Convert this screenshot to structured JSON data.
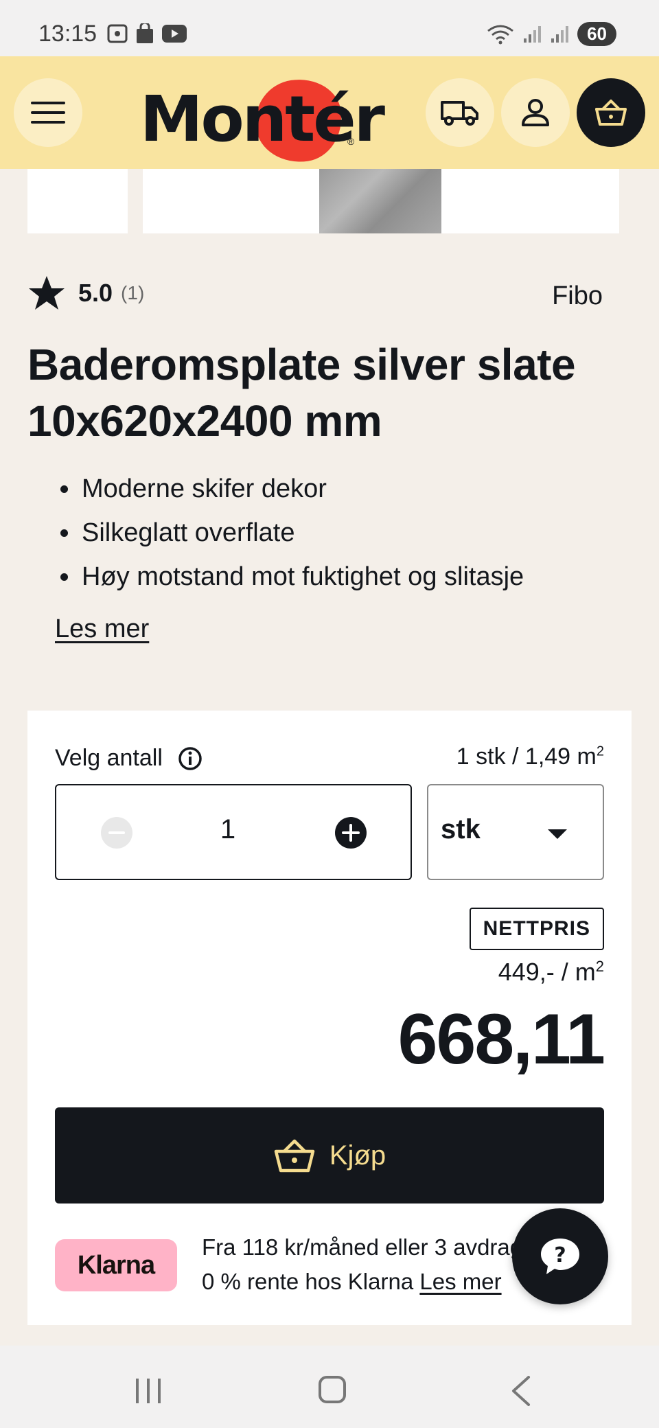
{
  "status_bar": {
    "time": "13:15",
    "battery": "60"
  },
  "header": {
    "logo": "Montér",
    "icons": [
      "menu-icon",
      "truck-icon",
      "user-icon",
      "cart-icon"
    ]
  },
  "product": {
    "rating": "5.0",
    "rating_count": "(1)",
    "brand": "Fibo",
    "title": "Baderomsplate silver slate 10x620x2400 mm",
    "features": [
      "Moderne skifer dekor",
      "Silkeglatt overflate",
      "Høy motstand mot fuktighet og slitasje"
    ],
    "read_more": "Les mer"
  },
  "purchase": {
    "quantity_label": "Velg antall",
    "unit_info": "1 stk / 1,49 m",
    "unit_info_sup": "2",
    "quantity": "1",
    "unit": "stk",
    "badge": "NETTPRIS",
    "unit_price": "449,- / m",
    "unit_price_sup": "2",
    "total": "668,11",
    "buy_label": "Kjøp"
  },
  "klarna": {
    "logo": "Klarna",
    "line1": "Fra 118 kr/måned eller 3 avdrag",
    "line2": "0 % rente hos Klarna",
    "link": "Les mer"
  },
  "colors": {
    "header_bg": "#f9e4a0",
    "page_bg": "#f4efe9",
    "dark": "#14171c",
    "accent_red": "#ef3b2d",
    "buy_text": "#f5dc8f",
    "klarna_pink": "#ffb3c7"
  }
}
